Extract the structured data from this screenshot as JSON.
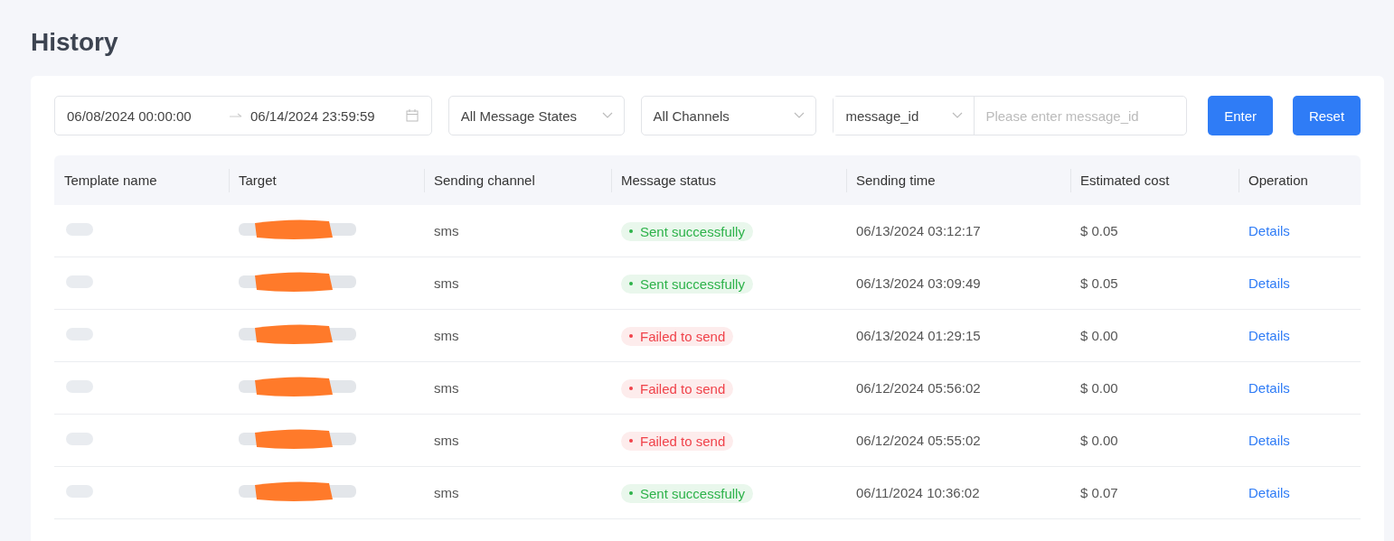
{
  "page": {
    "title": "History"
  },
  "filters": {
    "date_start": "06/08/2024 00:00:00",
    "date_end": "06/14/2024 23:59:59",
    "state_select": "All Message States",
    "channel_select": "All Channels",
    "search_field_select": "message_id",
    "search": {
      "placeholder": "Please enter message_id"
    },
    "buttons": [
      "Enter",
      "Reset"
    ]
  },
  "table": {
    "columns": [
      "Template name",
      "Target",
      "Sending channel",
      "Message status",
      "Sending time",
      "Estimated cost",
      "Operation"
    ],
    "rows": [
      {
        "channel": "sms",
        "status": {
          "kind": "success",
          "label": "Sent successfully"
        },
        "time": "06/13/2024 03:12:17",
        "cost": "$ 0.05",
        "action": "Details"
      },
      {
        "channel": "sms",
        "status": {
          "kind": "success",
          "label": "Sent successfully"
        },
        "time": "06/13/2024 03:09:49",
        "cost": "$ 0.05",
        "action": "Details"
      },
      {
        "channel": "sms",
        "status": {
          "kind": "failed",
          "label": "Failed to send"
        },
        "time": "06/13/2024 01:29:15",
        "cost": "$ 0.00",
        "action": "Details"
      },
      {
        "channel": "sms",
        "status": {
          "kind": "failed",
          "label": "Failed to send"
        },
        "time": "06/12/2024 05:56:02",
        "cost": "$ 0.00",
        "action": "Details"
      },
      {
        "channel": "sms",
        "status": {
          "kind": "failed",
          "label": "Failed to send"
        },
        "time": "06/12/2024 05:55:02",
        "cost": "$ 0.00",
        "action": "Details"
      },
      {
        "channel": "sms",
        "status": {
          "kind": "success",
          "label": "Sent successfully"
        },
        "time": "06/11/2024 10:36:02",
        "cost": "$ 0.07",
        "action": "Details"
      }
    ]
  }
}
